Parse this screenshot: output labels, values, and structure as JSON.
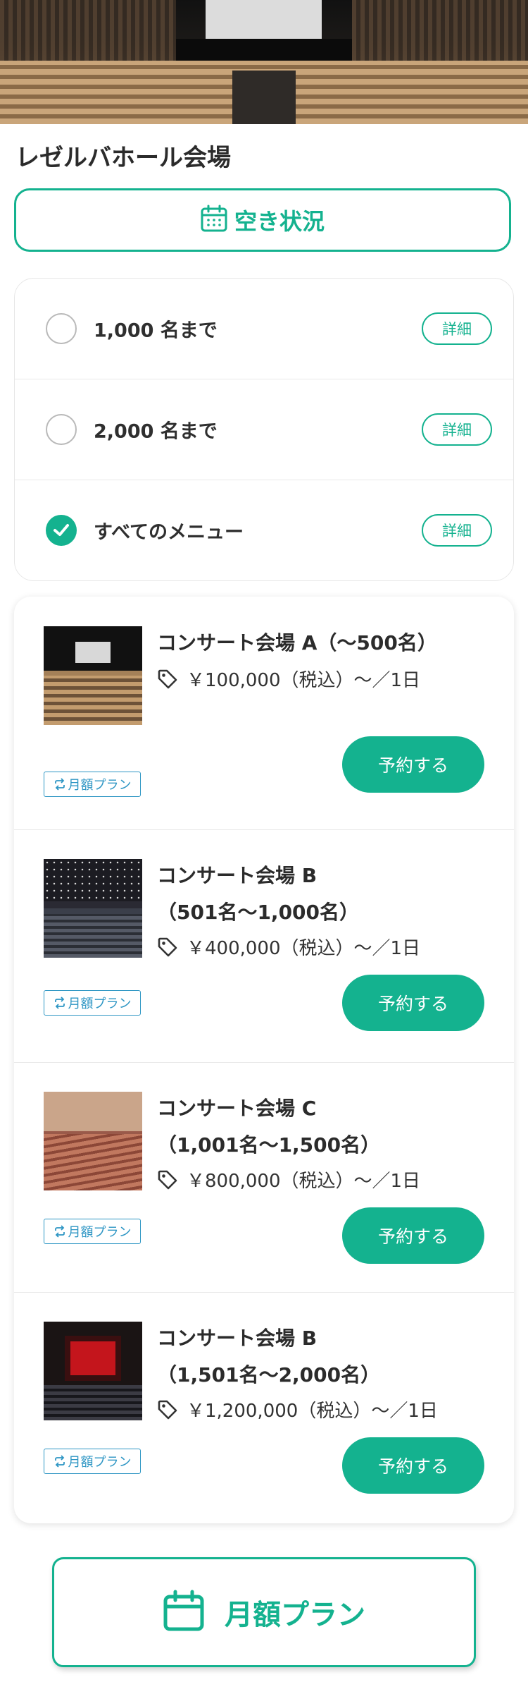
{
  "venue": {
    "title": "レゼルバホール会場"
  },
  "availability": {
    "label": "空き状況",
    "icon": "calendar-icon"
  },
  "menu": {
    "options": [
      {
        "label": "1,000 名まで",
        "detail": "詳細",
        "checked": false
      },
      {
        "label": "2,000 名まで",
        "detail": "詳細",
        "checked": false
      },
      {
        "label": "すべてのメニュー",
        "detail": "詳細",
        "checked": true
      }
    ]
  },
  "halls": [
    {
      "title_line1": "コンサート会場 A（〜500名）",
      "title_line2": "",
      "price": "￥100,000（税込）〜／1日",
      "plan_tag": "月額プラン",
      "reserve": "予約する"
    },
    {
      "title_line1": "コンサート会場 B",
      "title_line2": "（501名〜1,000名）",
      "price": "￥400,000（税込）〜／1日",
      "plan_tag": "月額プラン",
      "reserve": "予約する"
    },
    {
      "title_line1": "コンサート会場 C",
      "title_line2": "（1,001名〜1,500名）",
      "price": "￥800,000（税込）〜／1日",
      "plan_tag": "月額プラン",
      "reserve": "予約する"
    },
    {
      "title_line1": "コンサート会場 B",
      "title_line2": "（1,501名〜2,000名）",
      "price": "￥1,200,000（税込）〜／1日",
      "plan_tag": "月額プラン",
      "reserve": "予約する"
    }
  ],
  "monthly_plan": {
    "label": "月額プラン",
    "icon": "calendar-icon"
  },
  "colors": {
    "accent": "#14b28f",
    "tag": "#2e96c4",
    "text": "#2b2b2b"
  }
}
